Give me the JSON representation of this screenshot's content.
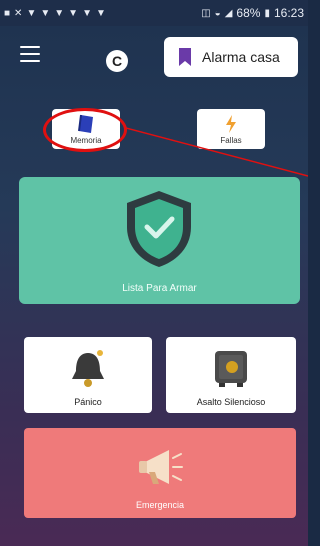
{
  "status_bar": {
    "battery": "68%",
    "time": "16:23"
  },
  "header": {
    "refresh_label": "C",
    "device_name": "Alarma casa"
  },
  "actions": {
    "memoria": "Memoria",
    "fallas": "Fallas"
  },
  "status": {
    "label": "Lista Para Armar"
  },
  "buttons": {
    "panico": "Pánico",
    "asalto": "Asalto Silencioso",
    "emergencia": "Emergencia"
  },
  "colors": {
    "status_card": "#5fc3a6",
    "emergency_card": "#ef7a7a",
    "highlight": "#e01010",
    "device_icon": "#6a3aa8"
  }
}
